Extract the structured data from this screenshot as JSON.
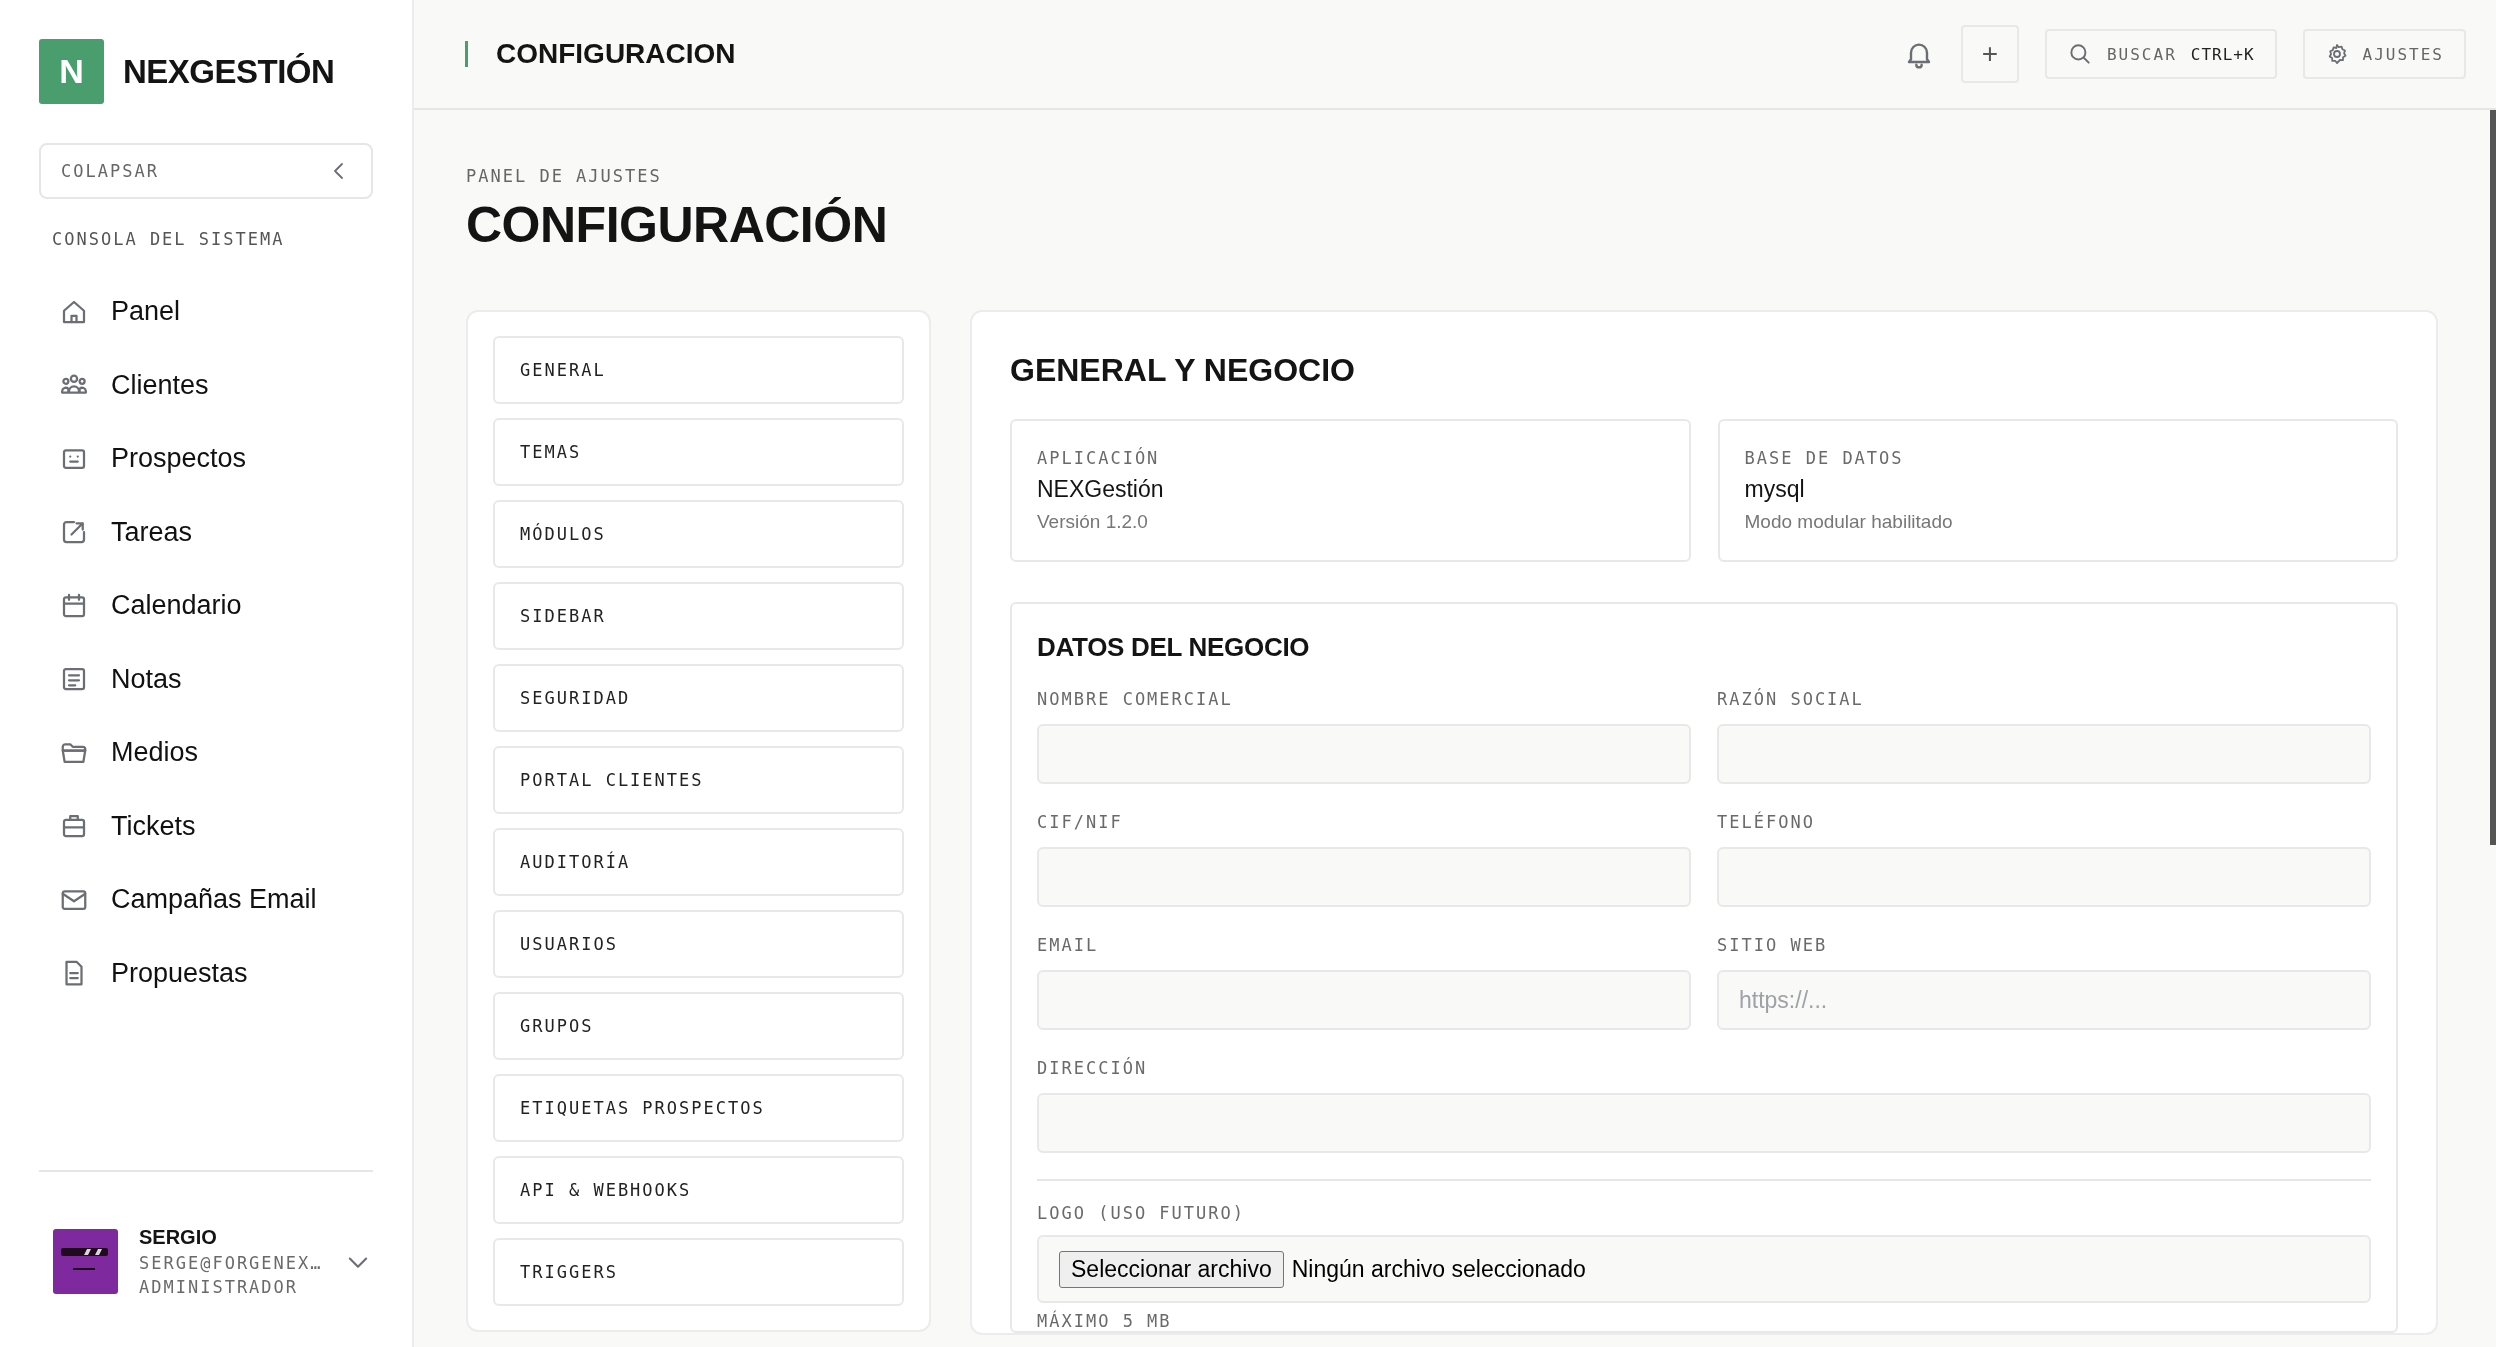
{
  "brand": {
    "logo_letter": "N",
    "name": "NEXGESTIÓN"
  },
  "collapse_button": {
    "label": "COLAPSAR"
  },
  "sidebar": {
    "section": "CONSOLA DEL SISTEMA",
    "items": [
      {
        "label": "Panel"
      },
      {
        "label": "Clientes"
      },
      {
        "label": "Prospectos"
      },
      {
        "label": "Tareas"
      },
      {
        "label": "Calendario"
      },
      {
        "label": "Notas"
      },
      {
        "label": "Medios"
      },
      {
        "label": "Tickets"
      },
      {
        "label": "Campañas Email"
      },
      {
        "label": "Propuestas"
      }
    ]
  },
  "user": {
    "name": "SERGIO",
    "email": "SERGE@FORGENEX…",
    "role": "ADMINISTRADOR"
  },
  "topbar": {
    "title": "CONFIGURACION",
    "add_button": "+",
    "search": {
      "label": "BUSCAR",
      "shortcut": "CTRL+K"
    },
    "settings_button": "AJUSTES"
  },
  "page": {
    "eyebrow": "PANEL DE AJUSTES",
    "title": "CONFIGURACIÓN"
  },
  "settings_nav": [
    {
      "label": "GENERAL"
    },
    {
      "label": "TEMAS"
    },
    {
      "label": "MÓDULOS"
    },
    {
      "label": "SIDEBAR"
    },
    {
      "label": "SEGURIDAD"
    },
    {
      "label": "PORTAL CLIENTES"
    },
    {
      "label": "AUDITORÍA"
    },
    {
      "label": "USUARIOS"
    },
    {
      "label": "GRUPOS"
    },
    {
      "label": "ETIQUETAS PROSPECTOS"
    },
    {
      "label": "API & WEBHOOKS"
    },
    {
      "label": "TRIGGERS"
    }
  ],
  "section": {
    "title": "GENERAL Y NEGOCIO",
    "info_cards": [
      {
        "label": "APLICACIÓN",
        "value": "NEXGestión",
        "detail": "Versión 1.2.0"
      },
      {
        "label": "BASE DE DATOS",
        "value": "mysql",
        "detail": "Modo modular habilitado"
      }
    ],
    "business": {
      "title": "DATOS DEL NEGOCIO",
      "fields": [
        {
          "label": "NOMBRE COMERCIAL",
          "kind": "half"
        },
        {
          "label": "RAZÓN SOCIAL",
          "kind": "half"
        },
        {
          "label": "CIF/NIF",
          "kind": "half"
        },
        {
          "label": "TELÉFONO",
          "kind": "half"
        },
        {
          "label": "EMAIL",
          "kind": "half"
        },
        {
          "label": "SITIO WEB",
          "kind": "half",
          "placeholder": "https://..."
        },
        {
          "label": "DIRECCIÓN",
          "kind": "wide"
        }
      ],
      "logo": {
        "label": "LOGO (USO FUTURO)",
        "button": "Seleccionar archivo",
        "status": "Ningún archivo seleccionado",
        "hint": "MÁXIMO 5 MB"
      }
    }
  }
}
